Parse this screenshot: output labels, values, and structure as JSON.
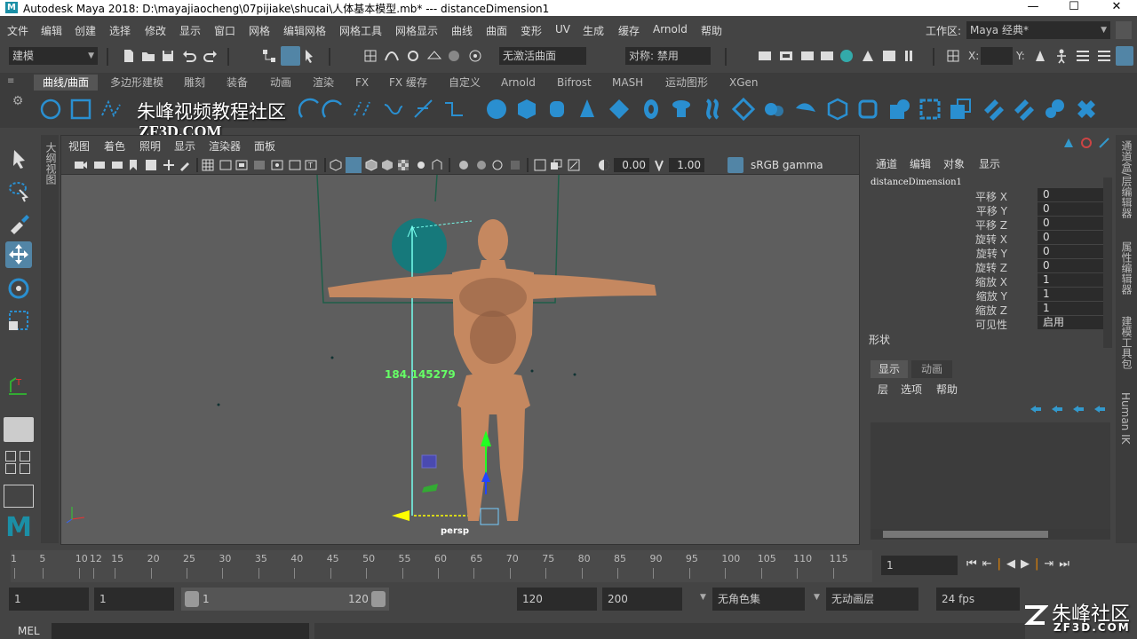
{
  "window": {
    "title": "Autodesk Maya 2018: D:\\mayajiaocheng\\07pijiake\\shucai\\人体基本模型.mb*   ---   distanceDimension1",
    "app_icon": "M",
    "minimize": "—",
    "maximize": "☐",
    "close": "✕"
  },
  "menubar": {
    "items": [
      "文件",
      "编辑",
      "创建",
      "选择",
      "修改",
      "显示",
      "窗口",
      "网格",
      "编辑网格",
      "网格工具",
      "网格显示",
      "曲线",
      "曲面",
      "变形",
      "UV",
      "生成",
      "缓存",
      "Arnold",
      "帮助"
    ],
    "workspace_label": "工作区:",
    "workspace_value": "Maya 经典*"
  },
  "statusline": {
    "mode": "建模",
    "live_surface": "无激活曲面",
    "symmetry": "对称: 禁用",
    "x_label": "X:",
    "y_label": "Y:"
  },
  "shelf": {
    "tabs": [
      "曲线/曲面",
      "多边形建模",
      "雕刻",
      "装备",
      "动画",
      "渲染",
      "FX",
      "FX 缓存",
      "自定义",
      "Arnold",
      "Bifrost",
      "MASH",
      "运动图形",
      "XGen"
    ],
    "active_tab": 0
  },
  "watermark": {
    "line1": "朱峰视频教程社区",
    "line2": "ZF3D.COM",
    "corner_main": "朱峰社区",
    "corner_sub": "ZF3D.COM"
  },
  "viewport": {
    "menu": [
      "视图",
      "着色",
      "照明",
      "显示",
      "渲染器",
      "面板"
    ],
    "exposure": "0.00",
    "gamma": "1.00",
    "color_space": "sRGB gamma",
    "camera_label": "persp",
    "distance_value": "184.145279",
    "outliner_tab": "大纲视图"
  },
  "channel_box": {
    "menu": [
      "通道",
      "编辑",
      "对象",
      "显示"
    ],
    "object_name": "distanceDimension1",
    "attributes": [
      {
        "label": "平移 X",
        "value": "0"
      },
      {
        "label": "平移 Y",
        "value": "0"
      },
      {
        "label": "平移 Z",
        "value": "0"
      },
      {
        "label": "旋转 X",
        "value": "0"
      },
      {
        "label": "旋转 Y",
        "value": "0"
      },
      {
        "label": "旋转 Z",
        "value": "0"
      },
      {
        "label": "缩放 X",
        "value": "1"
      },
      {
        "label": "缩放 Y",
        "value": "1"
      },
      {
        "label": "缩放 Z",
        "value": "1"
      },
      {
        "label": "可见性",
        "value": "启用"
      }
    ],
    "shapes_label": "形状"
  },
  "layer_editor": {
    "tabs": [
      "显示",
      "动画"
    ],
    "menu": [
      "层",
      "选项",
      "帮助"
    ]
  },
  "right_tabs": [
    "通道盒/层编辑器",
    "属性编辑器",
    "建模工具包",
    "Human IK"
  ],
  "timeline": {
    "ticks": [
      "1",
      "5",
      "10",
      "15",
      "20",
      "25",
      "30",
      "35",
      "40",
      "45",
      "50",
      "55",
      "60",
      "65",
      "70",
      "75",
      "80",
      "85",
      "90",
      "95",
      "100",
      "105",
      "110",
      "115",
      "12"
    ],
    "current_frame": "1"
  },
  "range": {
    "start": "1",
    "playback_start": "1",
    "slider_start": "1",
    "slider_end": "120",
    "playback_end": "120",
    "end": "200",
    "char_set": "无角色集",
    "anim_layer": "无动画层",
    "fps": "24 fps"
  },
  "command_line": {
    "label": "MEL"
  },
  "colors": {
    "bg": "#444444",
    "viewport": "#5e5e5e",
    "accent": "#5285a6",
    "shelf_blue": "#2a8fd0"
  }
}
